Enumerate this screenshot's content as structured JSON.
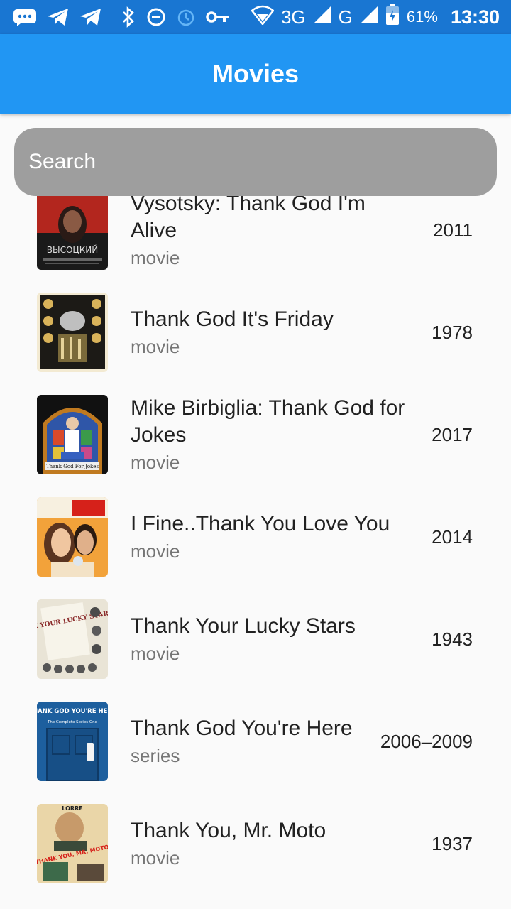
{
  "status_bar": {
    "icons": [
      "message-icon",
      "telegram-icon",
      "telegram-icon",
      "bluetooth-icon",
      "dnd-icon",
      "alarm-icon",
      "vpn-key-icon",
      "wifi-icon",
      "signal-icon",
      "signal-icon",
      "battery-icon"
    ],
    "network_1": "3G",
    "network_2": "G",
    "battery": "61%",
    "time": "13:30"
  },
  "app_bar": {
    "title": "Movies",
    "color": "#2196f3"
  },
  "search": {
    "placeholder": "Search",
    "value": ""
  },
  "movies": [
    {
      "title": "Vysotsky: Thank God I'm Alive",
      "type": "movie",
      "year": "2011",
      "poster_label": "ВЫСОЦКИЙ"
    },
    {
      "title": "Thank God It's Friday",
      "type": "movie",
      "year": "1978"
    },
    {
      "title": "Mike Birbiglia: Thank God for Jokes",
      "type": "movie",
      "year": "2017",
      "poster_label": "Thank God For Jokes"
    },
    {
      "title": "I Fine..Thank You Love You",
      "type": "movie",
      "year": "2014"
    },
    {
      "title": "Thank Your Lucky Stars",
      "type": "movie",
      "year": "1943",
      "poster_label": "THANK YOUR LUCKY STARS"
    },
    {
      "title": "Thank God You're Here",
      "type": "series",
      "year": "2006–2009",
      "poster_label": "THANK GOD YOU'RE HERE",
      "poster_sublabel": "The Complete Series One"
    },
    {
      "title": "Thank You, Mr. Moto",
      "type": "movie",
      "year": "1937",
      "poster_label": "THANK YOU, MR. MOTO",
      "poster_toplabel": "LORRE"
    }
  ]
}
